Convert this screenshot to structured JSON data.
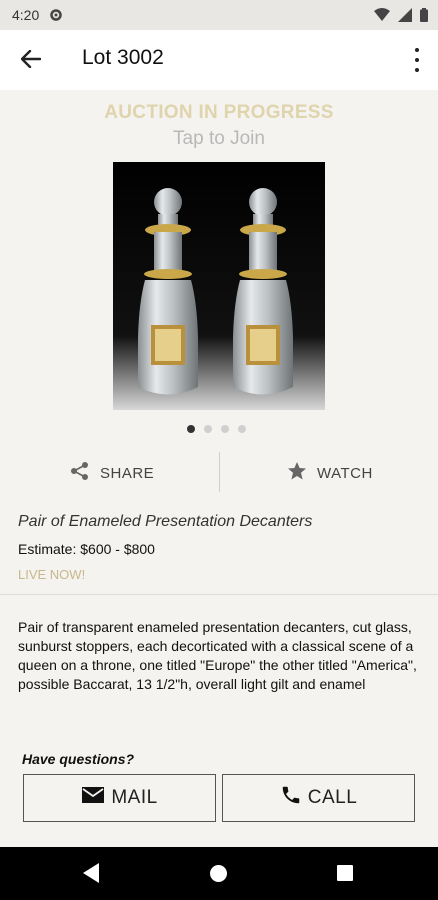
{
  "status_bar": {
    "time": "4:20",
    "icons": [
      "gear-icon",
      "wifi-icon",
      "signal-icon",
      "battery-icon"
    ]
  },
  "app_bar": {
    "title": "Lot 3002",
    "back_icon": "arrow-back-icon",
    "menu_icon": "more-vert-icon"
  },
  "banner": {
    "title": "AUCTION IN PROGRESS",
    "subtitle": "Tap to Join",
    "title_color": "#e0d4ad"
  },
  "gallery": {
    "image_count": 4,
    "active_index": 0
  },
  "actions": {
    "share_label": "SHARE",
    "watch_label": "WATCH"
  },
  "lot": {
    "title": "Pair of Enameled Presentation Decanters",
    "estimate": "Estimate: $600 - $800",
    "status": "LIVE NOW!",
    "status_color": "#c8b78a",
    "description": "Pair of transparent enameled presentation decanters, cut glass, sunburst stoppers, each decorticated with a classical scene of a queen on a throne, one titled \"Europe\" the other titled \"America\", possible Baccarat, 13 1/2\"h, overall light gilt and enamel"
  },
  "contact": {
    "heading": "Have questions?",
    "mail_label": "MAIL",
    "call_label": "CALL"
  },
  "nav_bar": {
    "icons": [
      "nav-back-icon",
      "nav-home-icon",
      "nav-recents-icon"
    ]
  }
}
